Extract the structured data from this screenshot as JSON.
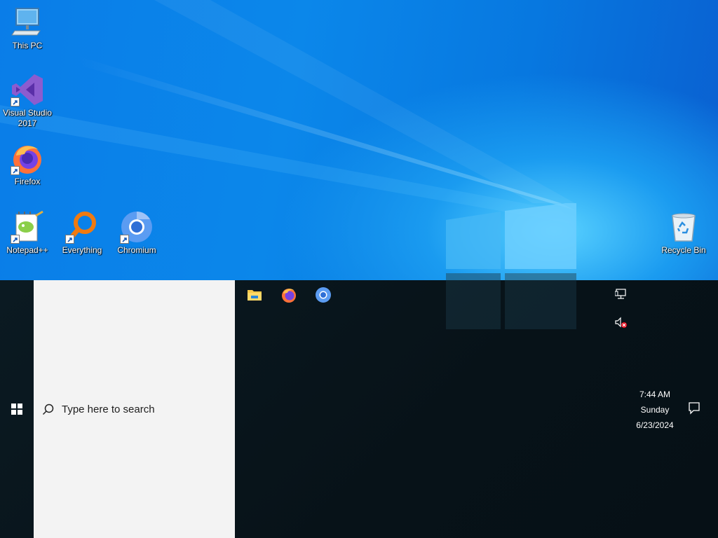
{
  "desktop": {
    "icons": [
      {
        "label": "This PC",
        "icon": "computer-icon"
      },
      {
        "label": "Visual Studio 2017",
        "icon": "visual-studio-icon"
      },
      {
        "label": "Firefox",
        "icon": "firefox-icon"
      },
      {
        "label": "Notepad++",
        "icon": "notepadpp-icon"
      },
      {
        "label": "Everything",
        "icon": "everything-search-icon"
      },
      {
        "label": "Chromium",
        "icon": "chromium-icon"
      },
      {
        "label": "Recycle Bin",
        "icon": "recycle-bin-icon"
      }
    ]
  },
  "taskbar": {
    "search_placeholder": "Type here to search",
    "pinned_apps": [
      {
        "name": "File Explorer",
        "icon": "folder-icon"
      },
      {
        "name": "Firefox",
        "icon": "firefox-icon"
      },
      {
        "name": "Chromium",
        "icon": "chromium-icon"
      }
    ],
    "tray": {
      "network_icon": "network-icon",
      "volume_icon": "volume-muted-icon"
    },
    "clock": {
      "time": "7:44 AM",
      "day": "Sunday",
      "date": "6/23/2024"
    }
  },
  "colors": {
    "desktop_blue": "#0b87ea",
    "taskbar": "#071218",
    "search_bg": "#f3f3f3"
  }
}
